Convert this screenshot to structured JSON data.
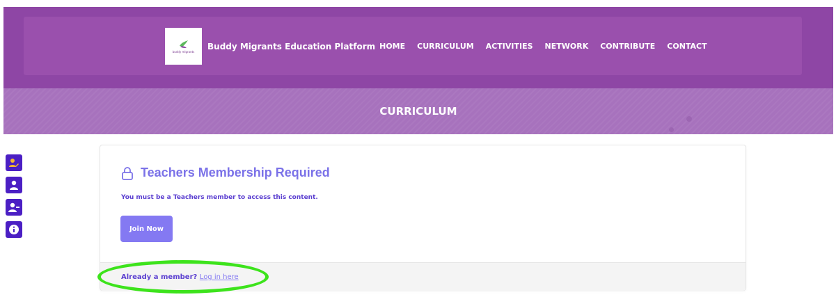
{
  "header": {
    "logo_text": "buddy migrants",
    "site_title": "Buddy Migrants Education Platform",
    "nav": [
      {
        "label": "HOME"
      },
      {
        "label": "CURRICULUM"
      },
      {
        "label": "ACTIVITIES"
      },
      {
        "label": "NETWORK"
      },
      {
        "label": "CONTRIBUTE"
      },
      {
        "label": "CONTACT"
      }
    ]
  },
  "banner": {
    "title": "CURRICULUM"
  },
  "side_tools": [
    "user-edit-icon",
    "user-icon",
    "user-minus-icon",
    "info-icon"
  ],
  "card": {
    "title": "Teachers Membership Required",
    "message": "You must be a Teachers member to access this content.",
    "join_label": "Join Now",
    "footer_prompt": "Already a member?",
    "login_link": "Log in here"
  },
  "colors": {
    "header": "#8e46a5",
    "banner": "#a772bd",
    "accent": "#8479f2",
    "side_buttons": "#4b1fc4",
    "highlight": "#3de31c"
  }
}
